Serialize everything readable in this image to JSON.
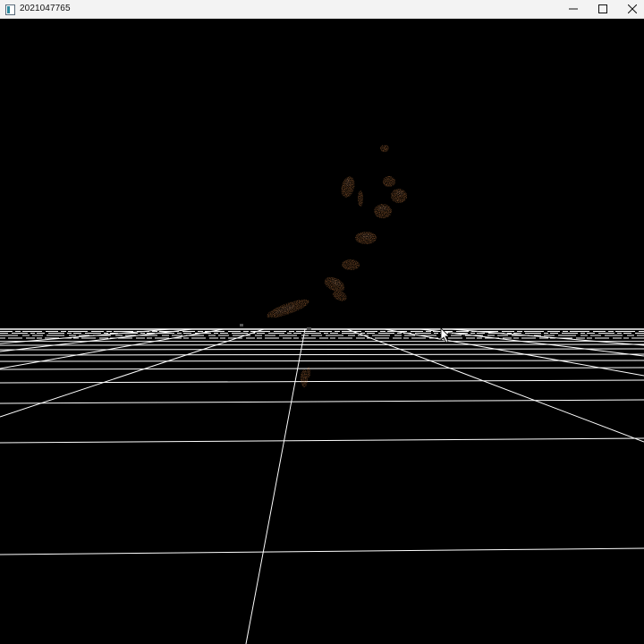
{
  "window": {
    "title": "2021047765",
    "icon": "app-window-icon",
    "controls": {
      "minimize_icon": "minimize-icon",
      "maximize_icon": "maximize-icon",
      "close_icon": "close-icon"
    }
  },
  "viewport": {
    "background_color": "#000000",
    "grid_color": "#ffffff",
    "point_cloud_color": "#b5713c",
    "point_cloud_highlight_color": "#e0a070",
    "cursor_icon": "mouse-pointer-icon"
  }
}
